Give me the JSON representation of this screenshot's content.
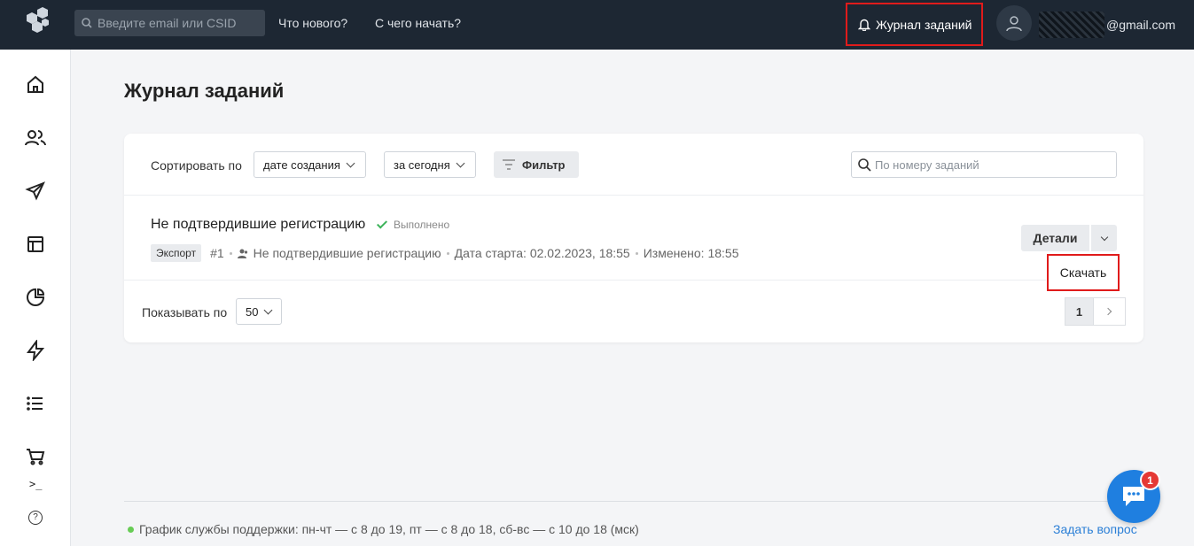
{
  "topbar": {
    "search_placeholder": "Введите email или CSID",
    "whats_new": "Что нового?",
    "getting_started": "С чего начать?",
    "tasks_log": "Журнал заданий",
    "user_email_suffix": "@gmail.com"
  },
  "sidebar": {
    "items": [
      "home-icon",
      "contacts-icon",
      "send-icon",
      "templates-icon",
      "stats-icon",
      "automation-icon",
      "lists-icon",
      "cart-icon"
    ],
    "terminal": ">_",
    "help": "?"
  },
  "main": {
    "title": "Журнал заданий",
    "sort_label": "Сортировать по",
    "sort_by": "дате создания",
    "period": "за сегодня",
    "filter": "Фильтр",
    "search_placeholder": "По номеру заданий",
    "task": {
      "title": "Не подтвердившие регистрацию",
      "status": "Выполнено",
      "tag": "Экспорт",
      "number": "#1",
      "segment": "Не подтвердившие регистрацию",
      "start_date": "Дата старта: 02.02.2023, 18:55",
      "changed": "Изменено: 18:55",
      "details": "Детали",
      "download": "Скачать"
    },
    "show_label": "Показывать по",
    "per_page": "50",
    "current_page": "1"
  },
  "footer": {
    "support": "График службы поддержки: пн-чт — с 8 до 19, пт — с 8 до 18, сб-вс — с 10 до 18 (мск)",
    "ask": "Задать вопрос"
  },
  "chat": {
    "badge": "1"
  },
  "colors": {
    "topbar": "#1d2733",
    "highlight": "#e01b1b",
    "link": "#2b7fd6",
    "chat": "#1f7fe0",
    "success": "#3cb35a"
  }
}
